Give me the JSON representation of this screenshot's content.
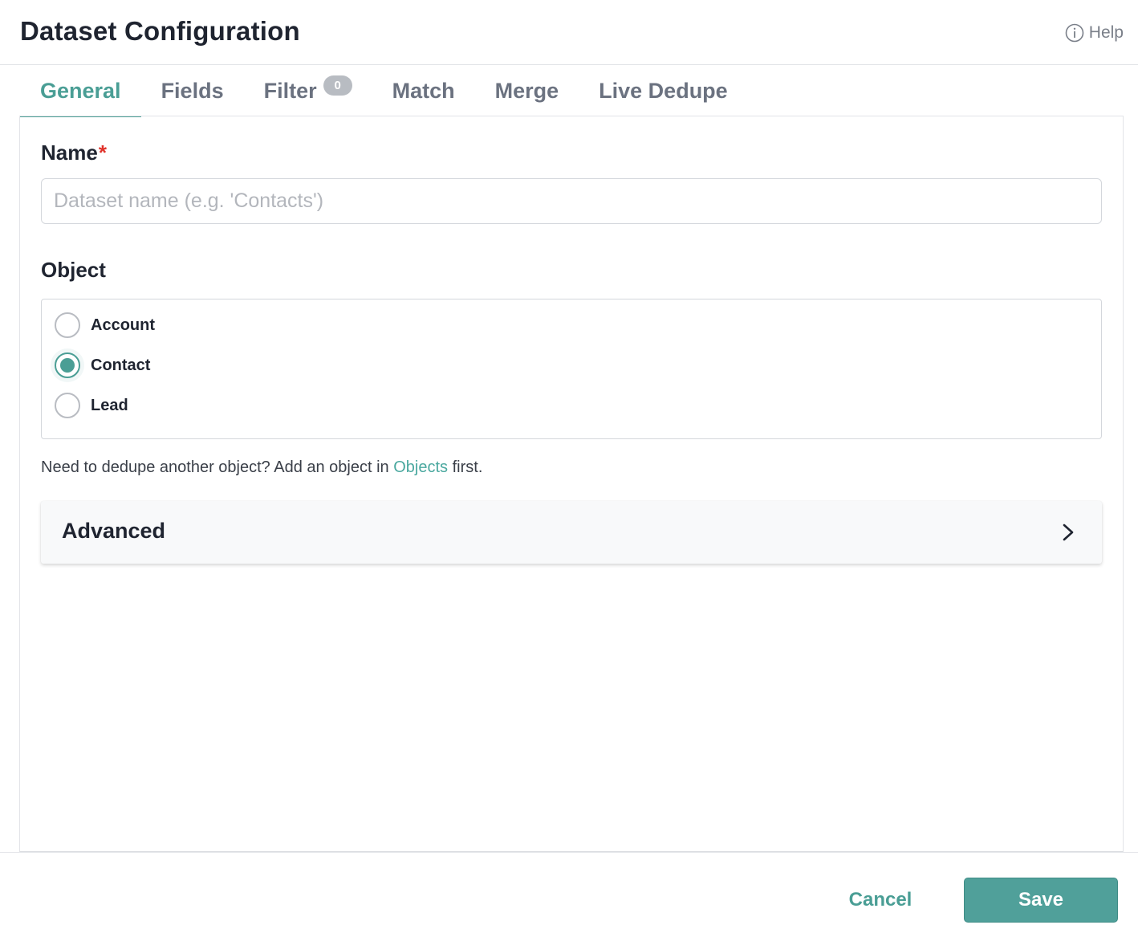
{
  "header": {
    "title": "Dataset Configuration",
    "help_label": "Help"
  },
  "tabs": [
    {
      "label": "General",
      "active": true
    },
    {
      "label": "Fields"
    },
    {
      "label": "Filter",
      "badge": "0"
    },
    {
      "label": "Match"
    },
    {
      "label": "Merge"
    },
    {
      "label": "Live Dedupe"
    }
  ],
  "form": {
    "name_label": "Name",
    "name_required_mark": "*",
    "name_value": "",
    "name_placeholder": "Dataset name (e.g. 'Contacts')",
    "object_label": "Object",
    "object_options": [
      {
        "label": "Account",
        "checked": false
      },
      {
        "label": "Contact",
        "checked": true
      },
      {
        "label": "Lead",
        "checked": false
      }
    ],
    "hint_before": "Need to dedupe another object? Add an object in ",
    "hint_link": "Objects",
    "hint_after": " first.",
    "advanced_label": "Advanced"
  },
  "footer": {
    "cancel_label": "Cancel",
    "save_label": "Save"
  },
  "colors": {
    "accent": "#4a9e95",
    "save_button": "#50a09a",
    "required": "#e0322a",
    "link": "#4aa89f"
  }
}
